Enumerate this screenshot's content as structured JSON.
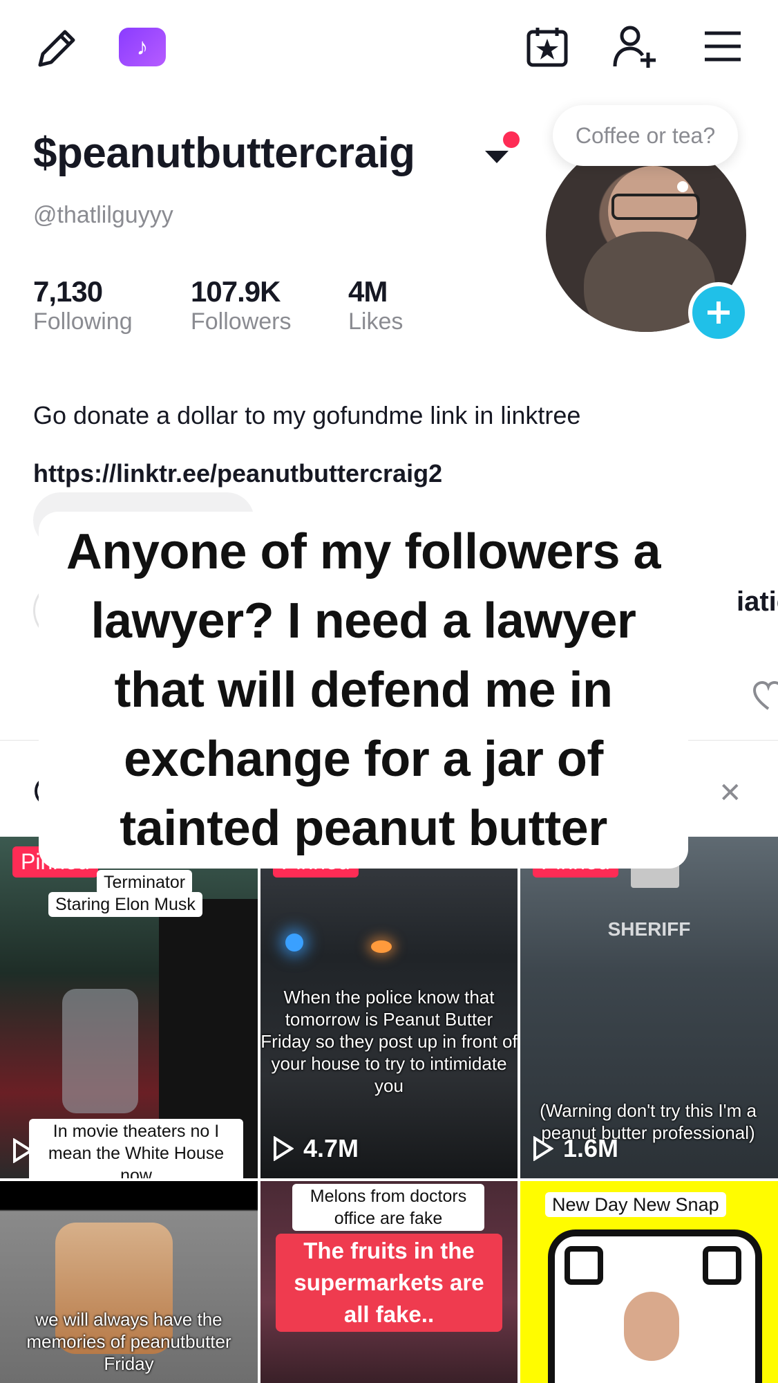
{
  "topbar": {
    "icons": [
      "edit-icon",
      "tiktok-badge-icon",
      "calendar-star-icon",
      "add-friend-icon",
      "menu-icon"
    ],
    "badge_glyph": "♪"
  },
  "profile": {
    "username": "$peanutbuttercraig",
    "handle": "@thatlilguyyy",
    "stats": [
      {
        "value": "7,130",
        "label": "Following"
      },
      {
        "value": "107.9K",
        "label": "Followers"
      },
      {
        "value": "4M",
        "label": "Likes"
      }
    ],
    "bio": "Go donate a dollar to my gofundme link in linktree",
    "link": "https://linktr.ee/peanutbuttercraig2",
    "avatar_bubble": "Coffee or tea?"
  },
  "partial": {
    "right_text": "iatic",
    "banner_initial": "V"
  },
  "overlay": {
    "text": "Anyone of my followers a lawyer? I need a lawyer that will defend me in exchange for a jar of tainted peanut butter"
  },
  "videos": [
    {
      "pinned": "Pinned",
      "top_label": "Terminator",
      "label2": "Staring Elon Musk",
      "bottom_label": "In movie theaters no I mean the White House now",
      "views": ""
    },
    {
      "pinned": "Pinned",
      "caption": "When the police know that tomorrow is Peanut Butter Friday so they post up in front of your house to try to intimidate you",
      "views": "4.7M"
    },
    {
      "pinned": "Pinned",
      "sign": "SHERIFF",
      "caption": "(Warning don't try this I'm a peanut butter professional)",
      "views": "1.6M"
    },
    {
      "caption": "we will always have the memories of peanutbutter Friday"
    },
    {
      "label": "Melons from doctors office are fake",
      "red": "The fruits in the supermarkets are all fake.."
    },
    {
      "label": "New Day New Snap"
    }
  ],
  "colors": {
    "accent": "#fe2c55",
    "plus": "#20c0e8",
    "badge": "#9a48ff",
    "snap_yellow": "#fffc00"
  }
}
